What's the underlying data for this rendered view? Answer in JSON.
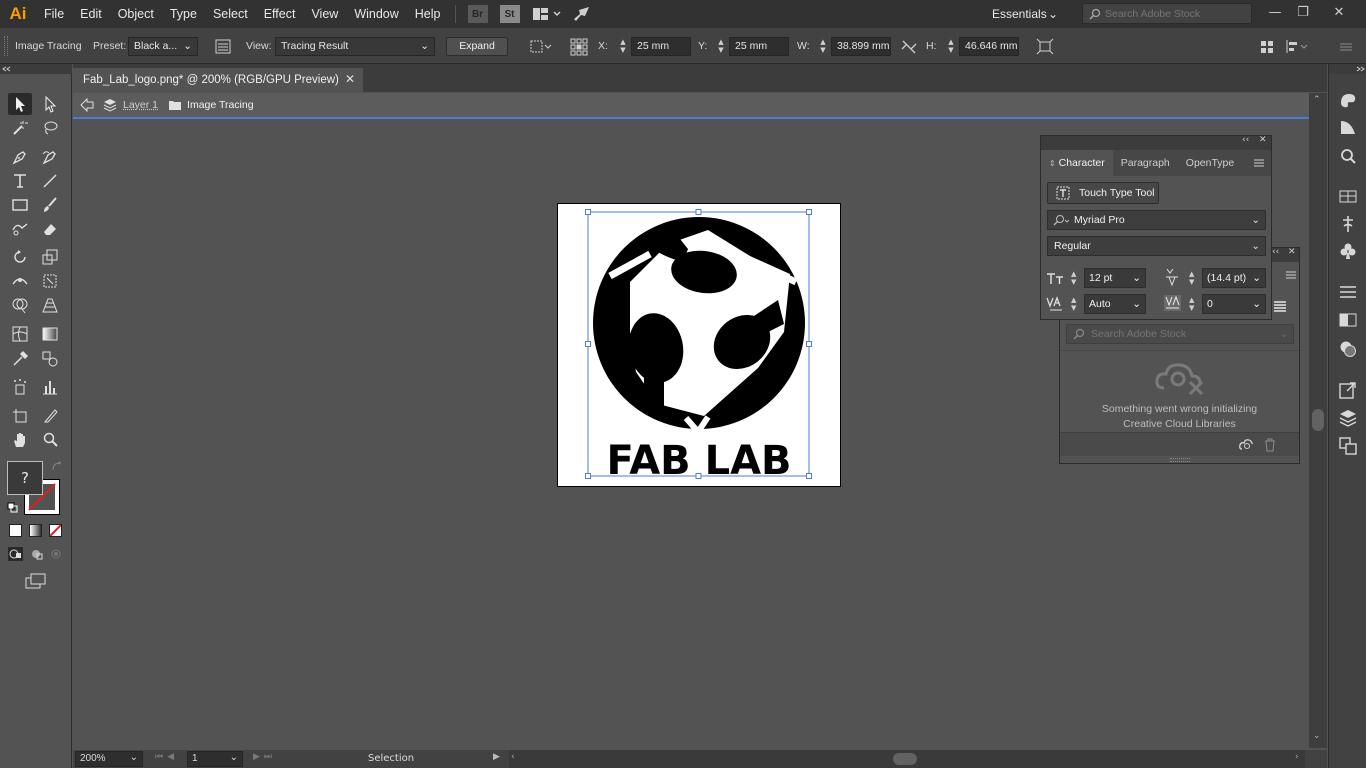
{
  "app": {
    "logo": "Ai"
  },
  "menu": [
    "File",
    "Edit",
    "Object",
    "Type",
    "Select",
    "Effect",
    "View",
    "Window",
    "Help"
  ],
  "app_buttons": [
    "Br",
    "St"
  ],
  "workspace": "Essentials",
  "stock_search": {
    "placeholder": "Search Adobe Stock"
  },
  "control": {
    "mode_label": "Image Tracing",
    "preset_label": "Preset:",
    "preset_value": "Black a...",
    "view_label": "View:",
    "view_value": "Tracing Result",
    "expand_label": "Expand",
    "x_label": "X:",
    "x_value": "25 mm",
    "y_label": "Y:",
    "y_value": "25 mm",
    "w_label": "W:",
    "w_value": "38.899 mm",
    "h_label": "H:",
    "h_value": "46.646 mm"
  },
  "document": {
    "tab_title": "Fab_Lab_logo.png* @ 200% (RGB/GPU Preview)"
  },
  "breadcrumb": {
    "layer": "Layer 1",
    "group": "Image Tracing"
  },
  "artwork": {
    "text": "FAB LAB"
  },
  "toolbar": {
    "unknown_tool": "?"
  },
  "character_panel": {
    "tabs": [
      "Character",
      "Paragraph",
      "OpenType"
    ],
    "touch_type": "Touch Type Tool",
    "font_family": "Myriad Pro",
    "font_style": "Regular",
    "font_size": "12 pt",
    "leading": "(14.4 pt)",
    "kerning": "Auto",
    "tracking": "0"
  },
  "libraries_panel": {
    "search_placeholder": "Search Adobe Stock",
    "error_line1": "Something went wrong initializing",
    "error_line2": "Creative Cloud Libraries"
  },
  "status": {
    "zoom": "200%",
    "artboard": "1",
    "tool": "Selection"
  }
}
